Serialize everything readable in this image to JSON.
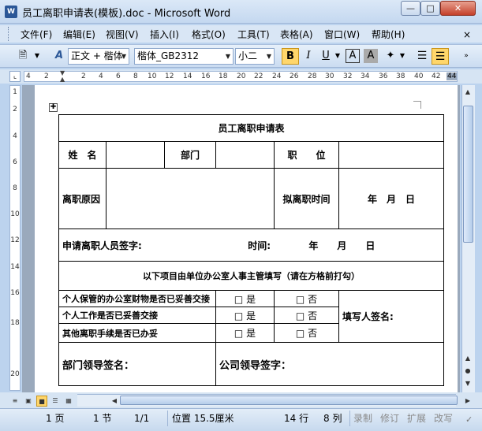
{
  "window": {
    "title": "员工离职申请表(模板).doc - Microsoft Word",
    "app_icon": "W"
  },
  "menu": [
    "文件(F)",
    "编辑(E)",
    "视图(V)",
    "插入(I)",
    "格式(O)",
    "工具(T)",
    "表格(A)",
    "窗口(W)",
    "帮助(H)"
  ],
  "toolbar": {
    "style_value": "正文 + 楷体",
    "font_value": "楷体_GB2312",
    "size_value": "小二",
    "bold": "B",
    "italic": "I",
    "underline": "U",
    "char_border": "A",
    "char_shade": "A"
  },
  "ruler": {
    "numbers": [
      "4",
      "2",
      "2",
      "4",
      "6",
      "8",
      "10",
      "12",
      "14",
      "16",
      "18",
      "20",
      "22",
      "24",
      "26",
      "28",
      "30",
      "32",
      "34",
      "36",
      "38",
      "40",
      "42",
      "44"
    ]
  },
  "vruler": {
    "numbers": [
      "1",
      "2",
      "4",
      "6",
      "8",
      "10",
      "12",
      "14",
      "16",
      "18",
      "20"
    ]
  },
  "form": {
    "title": "员工离职申请表",
    "row1": {
      "name_label": "姓　名",
      "dept_label": "部门",
      "position_label": "职　　位"
    },
    "row2": {
      "reason_label": "离职原因",
      "planned_date_label": "拟离职时间",
      "date_text": "年　月　日"
    },
    "row3": {
      "applicant_sign": "申请离职人员签字:",
      "time_label": "时间:",
      "date_text": "年　　月　　日"
    },
    "row4": {
      "note": "以下项目由单位办公室人事主管填写（请在方格前打勾）"
    },
    "checks": [
      {
        "item": "个人保管的办公室财物是否已妥善交接",
        "yes": "□ 是",
        "no": "□ 否"
      },
      {
        "item": "个人工作是否已妥善交接",
        "yes": "□ 是",
        "no": "□ 否"
      },
      {
        "item": "其他离职手续是否已办妥",
        "yes": "□ 是",
        "no": "□ 否"
      }
    ],
    "filler_sign": "填写人签名:",
    "dept_leader_sign": "部门领导签名：",
    "company_leader_sign": "公司领导签字："
  },
  "status": {
    "page": "1 页",
    "section": "1 节",
    "page_of": "1/1",
    "position": "位置 15.5厘米",
    "line": "14 行",
    "column": "8 列",
    "rec": "录制",
    "trk": "修订",
    "ext": "扩展",
    "ovr": "改写"
  }
}
